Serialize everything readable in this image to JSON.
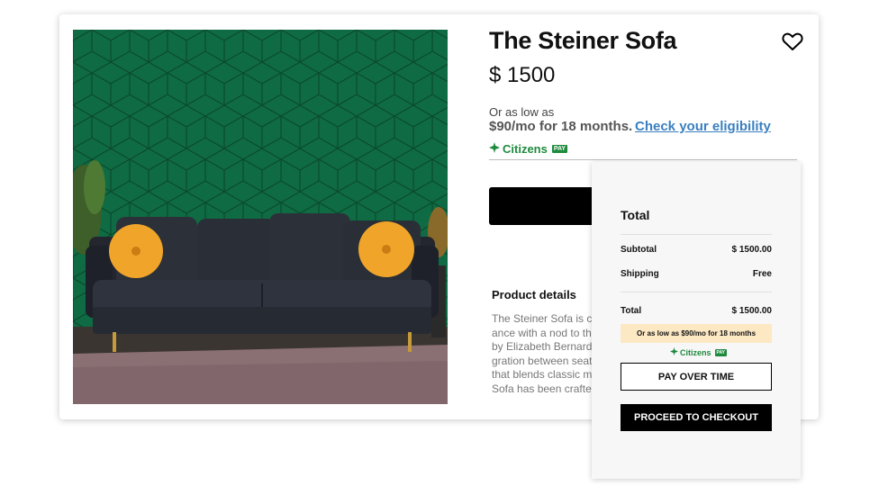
{
  "product": {
    "title": "The Steiner Sofa",
    "price": "$ 1500",
    "financing_prefix": "Or as low as",
    "financing_monthly": "$90/mo for 18 months.",
    "eligibility_link": "Check your eligibility",
    "lender_name": "Citizens",
    "lender_badge": "PAY",
    "details_heading": "Product details",
    "details_lines": [
      "The Steiner Sofa is cha",
      "ance with a nod to the",
      "by Elizabeth Bernardi",
      "gration between seat",
      "that blends classic mi",
      "Sofa has been crafted"
    ]
  },
  "cart": {
    "heading": "Total",
    "subtotal_label": "Subtotal",
    "subtotal_value": "$ 1500.00",
    "shipping_label": "Shipping",
    "shipping_value": "Free",
    "total_label": "Total",
    "total_value": "$ 1500.00",
    "promo_text": "Or as low as $90/mo for 18 months",
    "lender_name": "Citizens",
    "lender_badge": "PAY",
    "pay_over_time_label": "PAY OVER TIME",
    "checkout_label": "PROCEED TO CHECKOUT"
  },
  "icons": {
    "favorite": "heart-outline-icon",
    "lender_logo": "citizens-logo-icon"
  },
  "colors": {
    "wall_green": "#0f6b43",
    "link_blue": "#3a7fc0",
    "citizens_green": "#1d8a3c",
    "promo_bg": "#fde8c4"
  }
}
